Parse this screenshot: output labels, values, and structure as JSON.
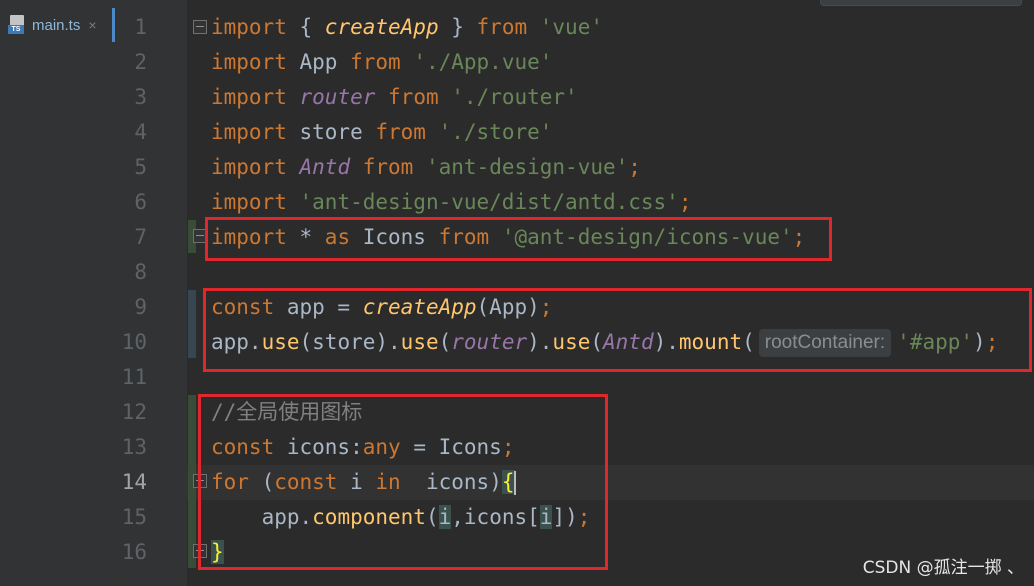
{
  "tab": {
    "badge": "TS",
    "label": "main.ts",
    "close": "×"
  },
  "editor": {
    "line_numbers": [
      "1",
      "2",
      "3",
      "4",
      "5",
      "6",
      "7",
      "8",
      "9",
      "10",
      "11",
      "12",
      "13",
      "14",
      "15",
      "16"
    ],
    "current_line": "14",
    "hint_label": "rootContainer:",
    "comment_text": "//全局使用图标"
  },
  "colors": {
    "background": "#2b2b2b",
    "keyword": "#cc7832",
    "string": "#6a8759",
    "function": "#ffc66d",
    "identifier_italic": "#9876aa",
    "annotation_box": "#e0282c"
  },
  "watermark": "CSDN @孤注一掷 、"
}
